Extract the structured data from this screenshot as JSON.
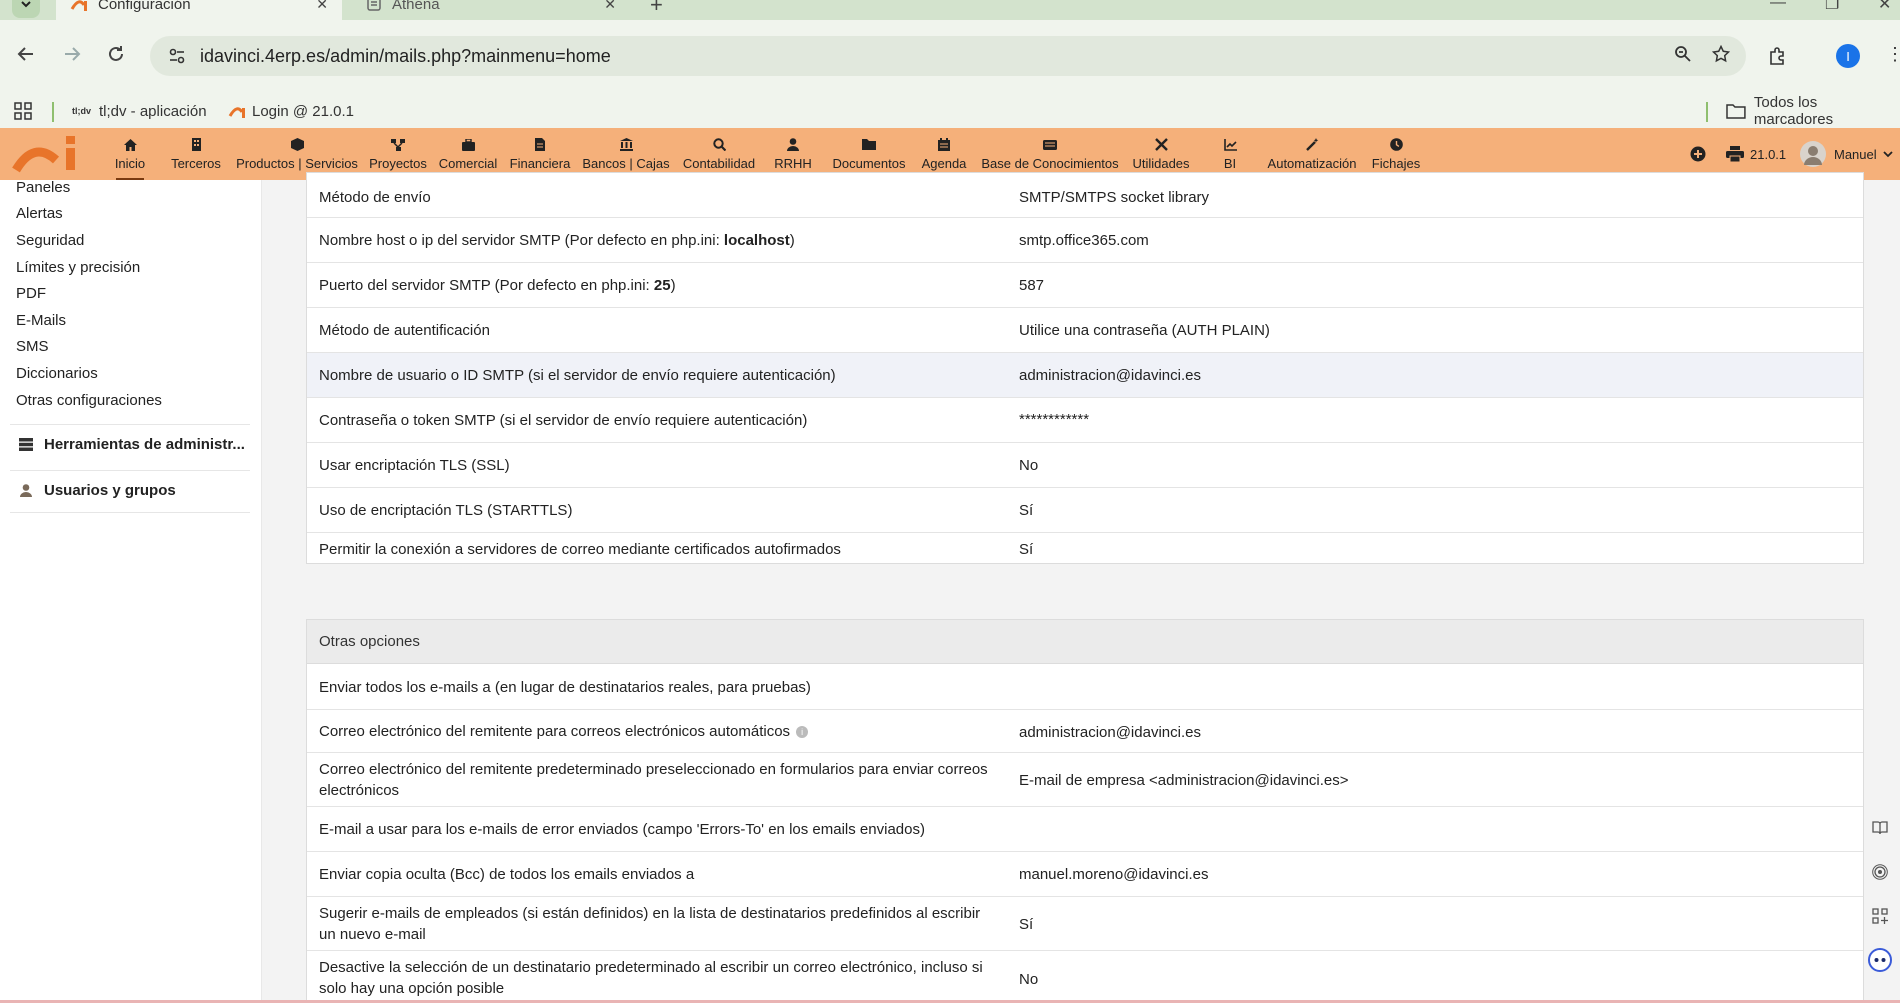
{
  "browser": {
    "tabs": [
      {
        "title": "Configuración",
        "active": true
      },
      {
        "title": "Athena",
        "active": false
      }
    ],
    "url": "idavinci.4erp.es/admin/mails.php?mainmenu=home",
    "profile_initial": "I",
    "bookmarks": [
      {
        "prefix": "tl;dv",
        "label": "tl;dv - aplicación"
      },
      {
        "label": "Login @ 21.0.1"
      }
    ],
    "all_bookmarks_label": "Todos los marcadores"
  },
  "appbar": {
    "menu": [
      {
        "label": "Inicio",
        "icon": "home-icon",
        "active": true
      },
      {
        "label": "Terceros",
        "icon": "building-icon"
      },
      {
        "label": "Productos | Servicios",
        "icon": "cube-icon"
      },
      {
        "label": "Proyectos",
        "icon": "sitemap-icon"
      },
      {
        "label": "Comercial",
        "icon": "suitcase-icon"
      },
      {
        "label": "Financiera",
        "icon": "file-invoice-icon"
      },
      {
        "label": "Bancos | Cajas",
        "icon": "bank-icon"
      },
      {
        "label": "Contabilidad",
        "icon": "search-dollar-icon"
      },
      {
        "label": "RRHH",
        "icon": "user-icon"
      },
      {
        "label": "Documentos",
        "icon": "folder-icon"
      },
      {
        "label": "Agenda",
        "icon": "calendar-icon"
      },
      {
        "label": "Base de Conocimientos",
        "icon": "ticket-icon"
      },
      {
        "label": "Utilidades",
        "icon": "tools-icon"
      },
      {
        "label": "BI",
        "icon": "chart-line-icon"
      },
      {
        "label": "Automatización",
        "icon": "magic-wand-icon"
      },
      {
        "label": "Fichajes",
        "icon": "clock-icon"
      }
    ],
    "version": "21.0.1",
    "user_name": "Manuel"
  },
  "sidebar": {
    "links": [
      "Paneles",
      "Alertas",
      "Seguridad",
      "Límites y precisión",
      "PDF",
      "E-Mails",
      "SMS",
      "Diccionarios",
      "Otras configuraciones"
    ],
    "groups": [
      {
        "label": "Herramientas de administr...",
        "icon": "server-icon"
      },
      {
        "label": "Usuarios y grupos",
        "icon": "user-icon"
      }
    ]
  },
  "smtp_panel": {
    "rows": [
      {
        "label": "Método de envío",
        "value": "SMTP/SMTPS socket library"
      },
      {
        "label": "Nombre host o ip del servidor SMTP (Por defecto en php.ini: ",
        "label_bold": "localhost",
        "label_after": ")",
        "value": "smtp.office365.com"
      },
      {
        "label": "Puerto del servidor SMTP (Por defecto en php.ini: ",
        "label_bold": "25",
        "label_after": ")",
        "value": "587"
      },
      {
        "label": "Método de autentificación",
        "value": "Utilice una contraseña (AUTH PLAIN)"
      },
      {
        "label": "Nombre de usuario o ID SMTP (si el servidor de envío requiere autenticación)",
        "value": "administracion@idavinci.es"
      },
      {
        "label": "Contraseña o token SMTP (si el servidor de envío requiere autenticación)",
        "value": "************"
      },
      {
        "label": "Usar encriptación TLS (SSL)",
        "value": "No"
      },
      {
        "label": "Uso de encriptación TLS (STARTTLS)",
        "value": "Sí"
      },
      {
        "label": "Permitir la conexión a servidores de correo mediante certificados autofirmados",
        "value": "Sí"
      }
    ]
  },
  "other_panel": {
    "title": "Otras opciones",
    "rows": [
      {
        "label": "Enviar todos los e-mails a (en lugar de destinatarios reales, para pruebas)",
        "value": ""
      },
      {
        "label": "Correo electrónico del remitente para correos electrónicos automáticos",
        "value": "administracion@idavinci.es"
      },
      {
        "label": "Correo electrónico del remitente predeterminado preseleccionado en formularios para enviar correos electrónicos",
        "value": "E-mail de empresa <administracion@idavinci.es>"
      },
      {
        "label": "E-mail a usar para los e-mails de error enviados (campo 'Errors-To' en los emails enviados)",
        "value": ""
      },
      {
        "label": "Enviar copia oculta (Bcc) de todos los emails enviados a",
        "value": "manuel.moreno@idavinci.es"
      },
      {
        "label": "Sugerir e-mails de empleados (si están definidos) en la lista de destinatarios predefinidos al escribir un nuevo e-mail",
        "value": "Sí"
      },
      {
        "label": "Desactive la selección de un destinatario predeterminado al escribir un correo electrónico, incluso si solo hay una opción posible",
        "value": "No"
      }
    ]
  },
  "colors": {
    "appbar": "#f5b07a",
    "browser_chrome": "#f0f4ed",
    "row_highlight": "#f0f2f8"
  }
}
